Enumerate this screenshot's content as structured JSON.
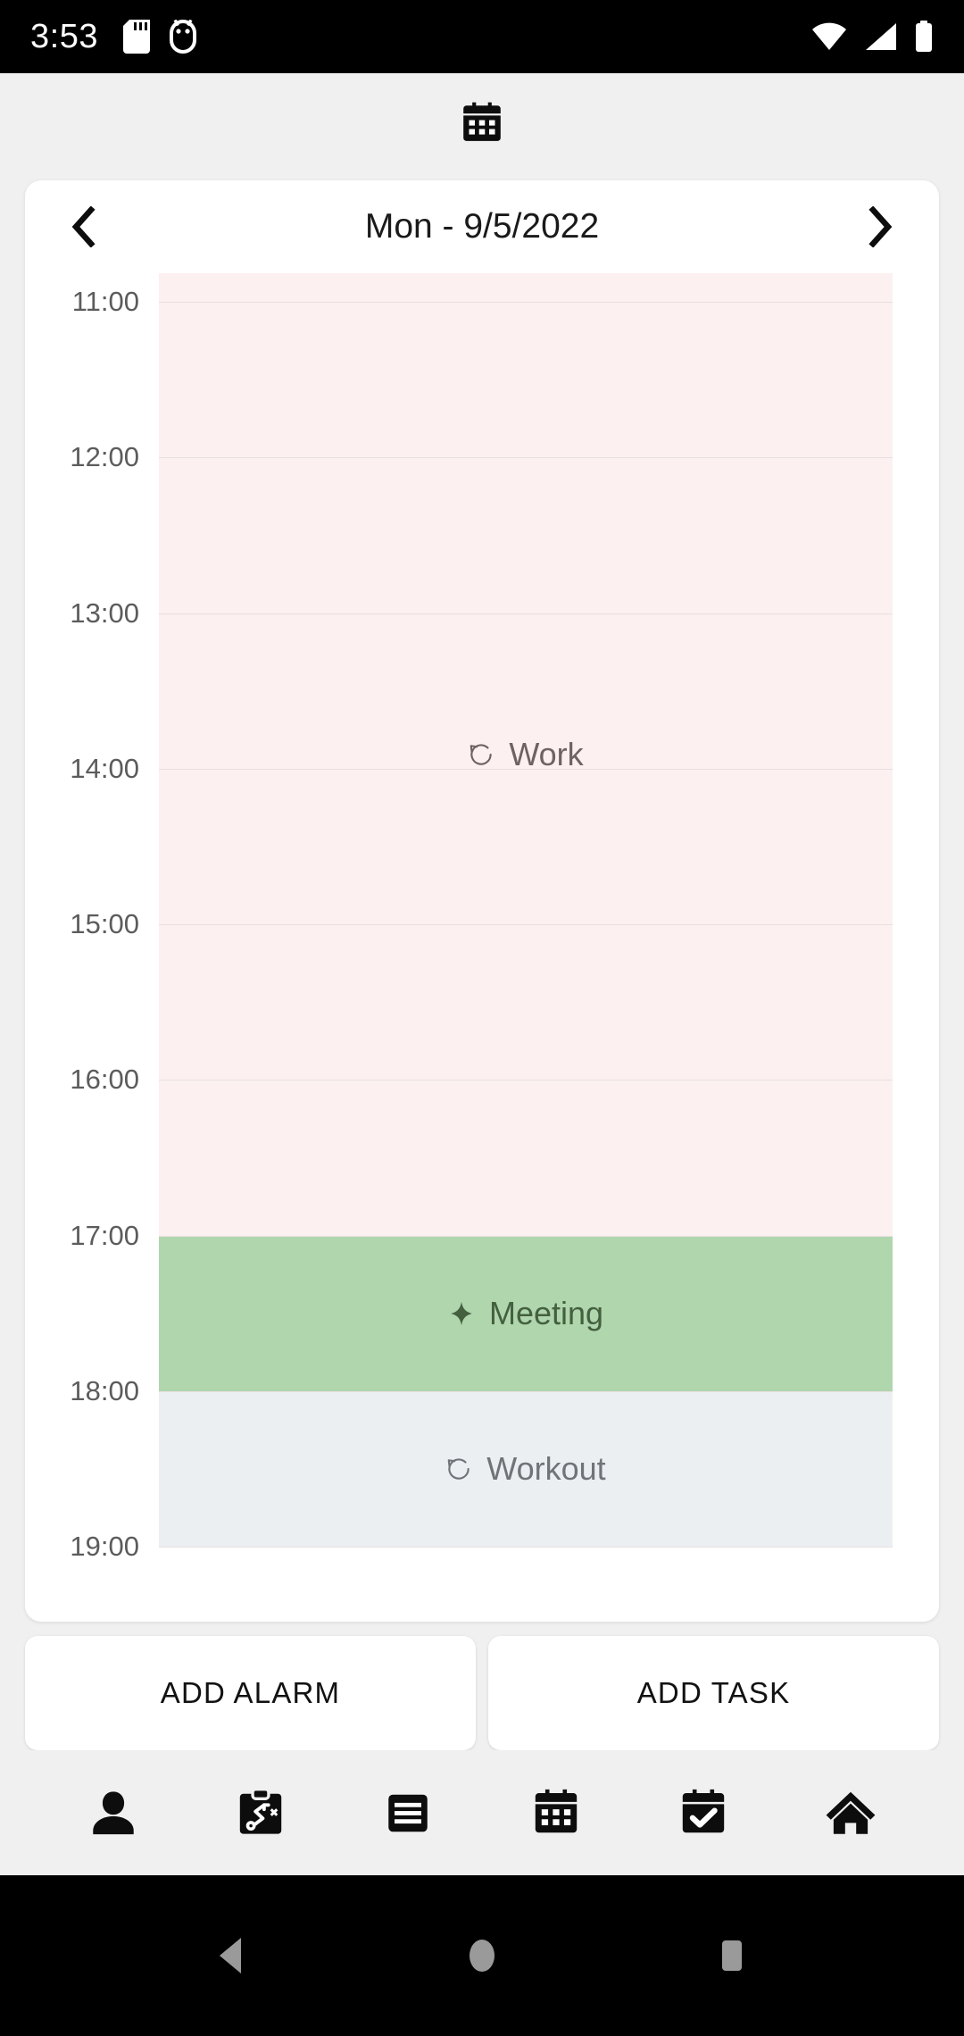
{
  "statusbar": {
    "clock": "3:53",
    "left_icons": [
      "sd-card-icon",
      "android-debug-icon"
    ],
    "right_icons": [
      "wifi-icon",
      "cellular-signal-icon",
      "battery-icon"
    ]
  },
  "appbar": {
    "icon": "calendar-icon"
  },
  "daynav": {
    "prev_icon": "chevron-left-icon",
    "next_icon": "chevron-right-icon",
    "title": "Mon - 9/5/2022"
  },
  "timeline": {
    "hours": [
      "11:00",
      "12:00",
      "13:00",
      "14:00",
      "15:00",
      "16:00",
      "17:00",
      "18:00",
      "19:00"
    ],
    "events": [
      {
        "label": "Work",
        "icon": "repeat-icon",
        "bg": "#fcf0f0",
        "text_color": "#6e6262",
        "start_hour": "10:40",
        "end_hour": "17:00"
      },
      {
        "label": "Meeting",
        "icon": "sparkle-icon",
        "bg": "#b0d6ae",
        "text_color": "#44603f",
        "start_hour": "17:00",
        "end_hour": "18:00"
      },
      {
        "label": "Workout",
        "icon": "repeat-icon",
        "bg": "#eceff1",
        "text_color": "#6f7478",
        "start_hour": "18:00",
        "end_hour": "19:00"
      }
    ]
  },
  "actions": {
    "add_alarm": "ADD ALARM",
    "add_task": "ADD TASK"
  },
  "bottomnav": {
    "items": [
      {
        "name": "profile",
        "icon": "person-icon"
      },
      {
        "name": "plan",
        "icon": "strategy-clipboard-icon"
      },
      {
        "name": "list",
        "icon": "list-icon"
      },
      {
        "name": "calendar",
        "icon": "calendar-icon"
      },
      {
        "name": "tasks",
        "icon": "calendar-check-icon"
      },
      {
        "name": "home",
        "icon": "home-icon"
      }
    ]
  },
  "sysnav": {
    "back": "back-triangle-icon",
    "home": "home-circle-icon",
    "recents": "recents-square-icon"
  },
  "colors": {
    "page_bg": "#f0f0f0",
    "card_bg": "#ffffff",
    "work_event": "#fcf0f0",
    "meeting_event": "#b0d6ae",
    "workout_event": "#eceff1",
    "hour_text": "#5c5c5c",
    "gridline": "#e8e0e0"
  }
}
